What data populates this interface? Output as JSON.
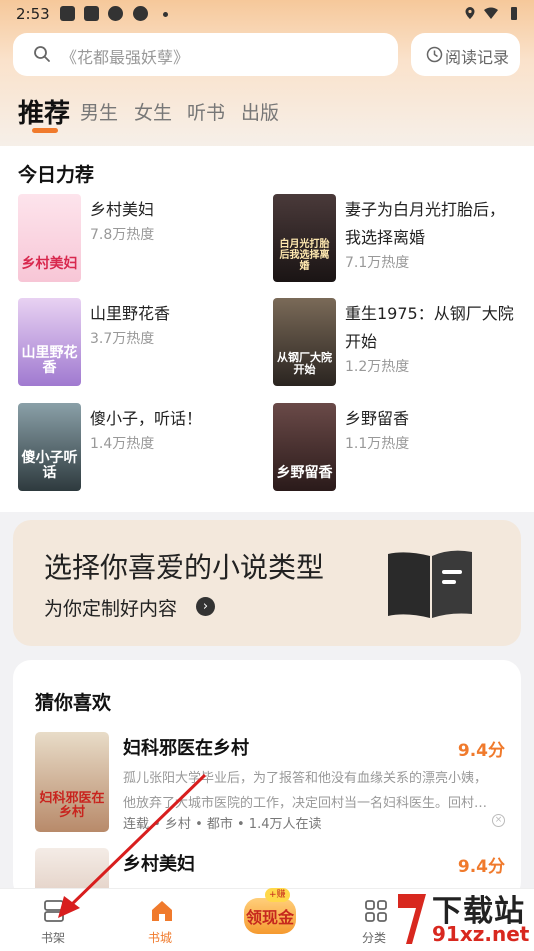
{
  "status_bar": {
    "time": "2:53"
  },
  "search": {
    "placeholder": "《花都最强妖孽》",
    "history_label": "阅读记录"
  },
  "tabs": [
    {
      "label": "推荐"
    },
    {
      "label": "男生"
    },
    {
      "label": "女生"
    },
    {
      "label": "听书"
    },
    {
      "label": "出版"
    }
  ],
  "today_picks": {
    "title": "今日力荐",
    "items": [
      {
        "title": "乡村美妇",
        "heat": "7.8万热度",
        "cover_text": "乡村美妇"
      },
      {
        "title": "妻子为白月光打胎后，我选择离婚",
        "heat": "7.1万热度",
        "cover_text": "白月光打胎后我选择离婚"
      },
      {
        "title": "山里野花香",
        "heat": "3.7万热度",
        "cover_text": "山里野花香"
      },
      {
        "title": "重生1975：从钢厂大院开始",
        "heat": "1.2万热度",
        "cover_text": "从钢厂大院开始"
      },
      {
        "title": "傻小子，听话！",
        "heat": "1.4万热度",
        "cover_text": "傻小子听话"
      },
      {
        "title": "乡野留香",
        "heat": "1.1万热度",
        "cover_text": "乡野留香"
      }
    ]
  },
  "banner": {
    "title": "选择你喜爱的小说类型",
    "subtitle": "为你定制好内容"
  },
  "guess": {
    "title": "猜你喜欢",
    "items": [
      {
        "title": "妇科邪医在乡村",
        "score": "9.4分",
        "desc": "孤儿张阳大学毕业后，为了报答和他没有血缘关系的漂亮小姨，他放弃了大城市医院的工作，决定回村当一名妇科医生。回村…",
        "meta": "连载 • 乡村 • 都市 • 1.4万人在读",
        "cover_text": "妇科邪医在乡村"
      },
      {
        "title": "乡村美妇",
        "score": "9.4分"
      }
    ]
  },
  "nav": [
    {
      "label": "书架"
    },
    {
      "label": "书城"
    },
    {
      "label": "领现金",
      "tag": "+赚"
    },
    {
      "label": "分类"
    }
  ],
  "watermark": {
    "main": "下载站",
    "site": "91xz.net"
  },
  "colors": {
    "accent": "#f07a2c"
  }
}
